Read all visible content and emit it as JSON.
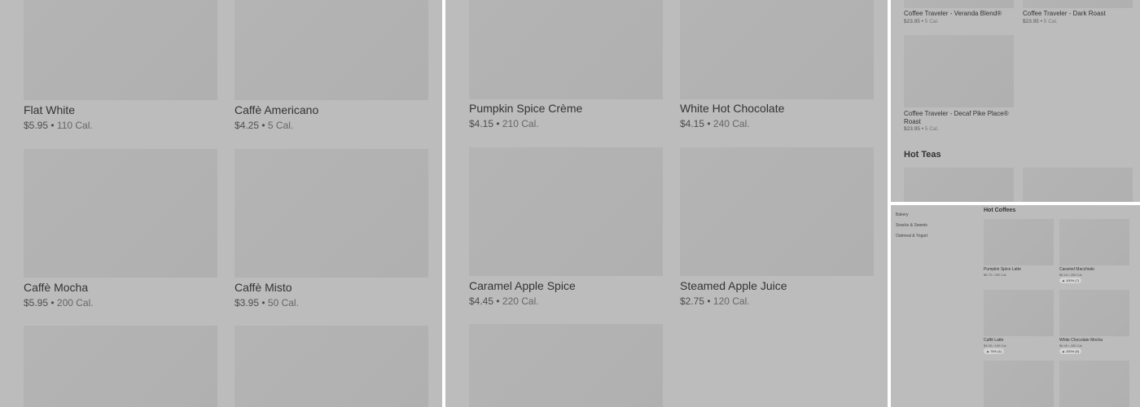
{
  "panel1": {
    "items": [
      {
        "name": "Flat White",
        "price": "$5.95",
        "cal": "110 Cal."
      },
      {
        "name": "Caffè Americano",
        "price": "$4.25",
        "cal": "5 Cal."
      },
      {
        "name": "Caffè Mocha",
        "price": "$5.95",
        "cal": "200 Cal."
      },
      {
        "name": "Caffè Misto",
        "price": "$3.95",
        "cal": "50 Cal."
      }
    ]
  },
  "panel2": {
    "items": [
      {
        "name": "Pumpkin Spice Crème",
        "price": "$4.15",
        "cal": "210 Cal."
      },
      {
        "name": "White Hot Chocolate",
        "price": "$4.15",
        "cal": "240 Cal."
      },
      {
        "name": "Caramel Apple Spice",
        "price": "$4.45",
        "cal": "220 Cal."
      },
      {
        "name": "Steamed Apple Juice",
        "price": "$2.75",
        "cal": "120 Cal."
      }
    ]
  },
  "panel3": {
    "items": [
      {
        "name": "Coffee Traveler - Veranda Blend®",
        "price": "$23.95",
        "cal": "5 Cal."
      },
      {
        "name": "Coffee Traveler - Dark Roast",
        "price": "$23.95",
        "cal": "5 Cal."
      },
      {
        "name_line1": "Coffee Traveler - Decaf Pike Place®",
        "name_line2": "Roast",
        "price": "$23.95",
        "cal": "5 Cal."
      }
    ],
    "section_title": "Hot Teas"
  },
  "panel4": {
    "categories": [
      "Bakery",
      "Snacks & Sweets",
      "Oatmeal & Yogurt"
    ],
    "section_title": "Hot Coffees",
    "items": [
      {
        "name": "Pumpkin Spice Latte",
        "price": "$6.75",
        "cal": "390 Cal."
      },
      {
        "name": "Caramel Macchiato",
        "price": "$6.15",
        "cal": "250 Cal.",
        "rating": "100% (7)"
      },
      {
        "name": "Caffè Latte",
        "price": "$5.35",
        "cal": "190 Cal.",
        "rating": "75% (4)"
      },
      {
        "name": "White Chocolate Mocha",
        "price": "$6.45",
        "cal": "430 Cal.",
        "rating": "100% (5)"
      }
    ]
  }
}
